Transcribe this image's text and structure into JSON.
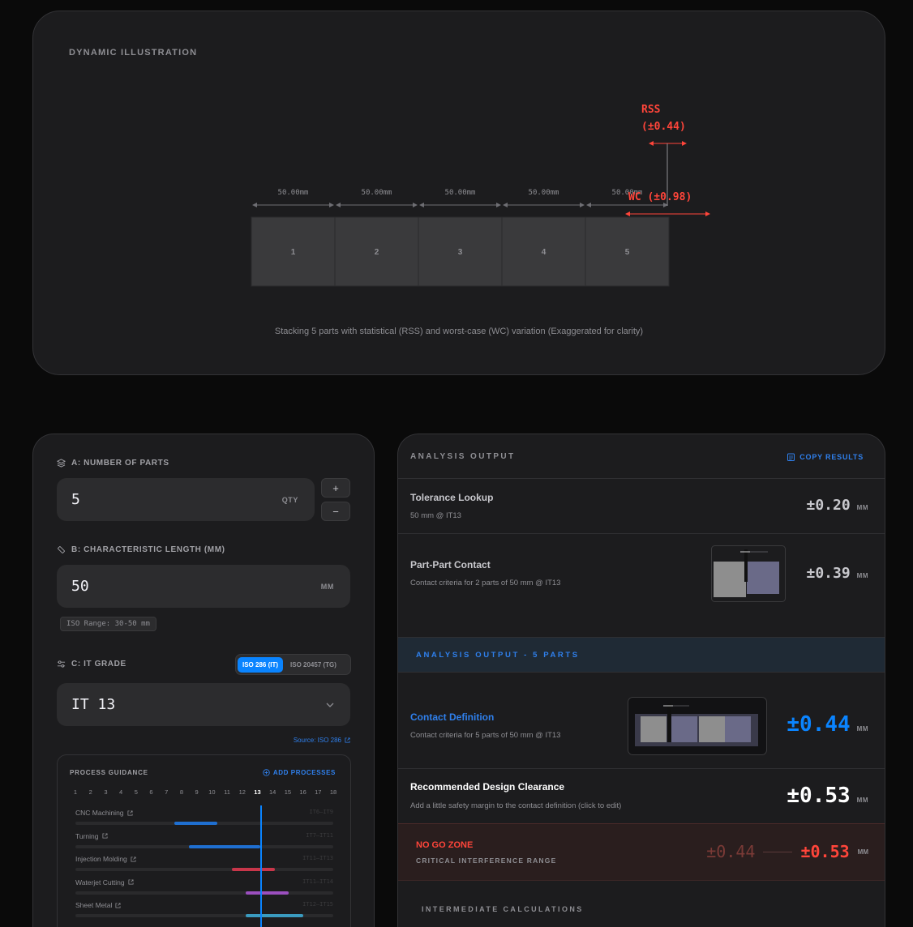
{
  "illustration": {
    "title": "DYNAMIC ILLUSTRATION",
    "part_labels": [
      "1",
      "2",
      "3",
      "4",
      "5"
    ],
    "dimension_label": "50.00mm",
    "rss_label": "RSS",
    "rss_value": "(±0.44)",
    "wc_label": "WC (±0.98)",
    "caption": "Stacking 5 parts with statistical (RSS) and worst-case (WC) variation (Exaggerated for clarity)"
  },
  "inputs": {
    "parts": {
      "label": "A: NUMBER OF PARTS",
      "value": "5",
      "unit": "QTY",
      "plus": "+",
      "minus": "−"
    },
    "length": {
      "label": "B: CHARACTERISTIC LENGTH (MM)",
      "value": "50",
      "unit": "MM",
      "range": "ISO Range: 30-50 mm"
    },
    "grade": {
      "label": "C: IT GRADE",
      "standards": [
        "ISO 286 (IT)",
        "ISO 20457 (TG)"
      ],
      "value": "IT 13",
      "source": "Source: ISO 286"
    }
  },
  "process": {
    "title": "PROCESS GUIDANCE",
    "add_label": "ADD PROCESSES",
    "grades": [
      "1",
      "2",
      "3",
      "4",
      "5",
      "6",
      "7",
      "8",
      "9",
      "10",
      "11",
      "12",
      "13",
      "14",
      "15",
      "16",
      "17",
      "18"
    ],
    "current_grade": 13,
    "items": [
      {
        "name": "CNC Machining",
        "range": "IT6–IT9",
        "from": 7,
        "to": 10,
        "color": "#1f6fd1"
      },
      {
        "name": "Turning",
        "range": "IT7–IT11",
        "from": 8,
        "to": 13,
        "color": "#1f6fd1"
      },
      {
        "name": "Injection Molding",
        "range": "IT11–IT13",
        "from": 11,
        "to": 14,
        "color": "#c8364a"
      },
      {
        "name": "Waterjet Cutting",
        "range": "IT11–IT14",
        "from": 12,
        "to": 15,
        "color": "#9b4fbf"
      },
      {
        "name": "Sheet Metal",
        "range": "IT12–IT15",
        "from": 12,
        "to": 16,
        "color": "#3a9bbf"
      }
    ]
  },
  "output": {
    "title": "ANALYSIS OUTPUT",
    "copy_label": "COPY RESULTS",
    "lookup": {
      "title": "Tolerance Lookup",
      "sub": "50 mm @ IT13",
      "value": "±0.20",
      "unit": "MM"
    },
    "contact2": {
      "title": "Part-Part Contact",
      "sub": "Contact criteria for 2 parts of 50 mm @ IT13",
      "value": "±0.39",
      "unit": "MM"
    },
    "band_title": "ANALYSIS OUTPUT - 5 PARTS",
    "contact5": {
      "title": "Contact Definition",
      "sub": "Contact criteria for 5 parts of 50 mm @ IT13",
      "value": "±0.44",
      "unit": "MM"
    },
    "clearance": {
      "title": "Recommended Design Clearance",
      "sub": "Add a little safety margin to the contact definition (click to edit)",
      "value": "±0.53",
      "unit": "MM"
    },
    "nogo": {
      "title": "NO GO ZONE",
      "sub": "CRITICAL INTERFERENCE RANGE",
      "from": "±0.44",
      "to": "±0.53",
      "unit": "MM"
    },
    "intermediate": "INTERMEDIATE CALCULATIONS"
  },
  "colors": {
    "accent": "#0a84ff",
    "danger": "#ff453a",
    "card": "#1c1c1e"
  }
}
